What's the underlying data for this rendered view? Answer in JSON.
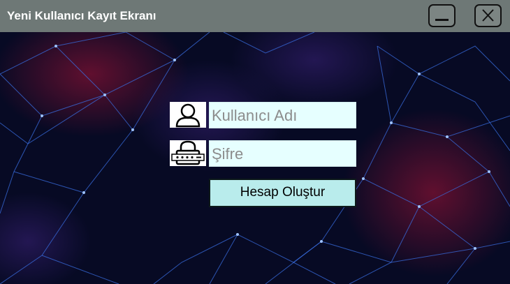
{
  "window": {
    "title": "Yeni Kullanıcı Kayıt Ekranı"
  },
  "title_bar_buttons": {
    "minimize_icon": "minimize-icon",
    "close_icon": "close-icon"
  },
  "form": {
    "username": {
      "value": "",
      "placeholder": "Kullanıcı Adı",
      "icon": "user-icon"
    },
    "password": {
      "value": "",
      "placeholder": "Şifre",
      "icon": "lock-icon"
    },
    "submit_label": "Hesap Oluştur"
  },
  "colors": {
    "background": "#070a24",
    "title_bar": "#6e7876",
    "input_bg": "#e6ffff",
    "button_bg": "#b9ecec",
    "network_lines": "#3a6de0"
  }
}
